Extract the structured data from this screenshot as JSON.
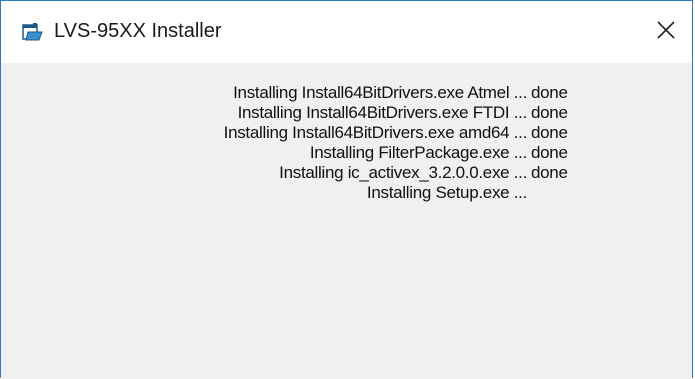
{
  "window": {
    "title": "LVS-95XX Installer",
    "app_icon": "installer-window-icon",
    "close_icon": "close-icon"
  },
  "log": {
    "lines": [
      {
        "text": "Installing Install64BitDrivers.exe Atmel ...",
        "status": "done"
      },
      {
        "text": "Installing Install64BitDrivers.exe FTDI ...",
        "status": "done"
      },
      {
        "text": "Installing Install64BitDrivers.exe amd64 ...",
        "status": "done"
      },
      {
        "text": "Installing FilterPackage.exe ...",
        "status": "done"
      },
      {
        "text": "Installing ic_activex_3.2.0.0.exe ...",
        "status": "done"
      },
      {
        "text": "Installing Setup.exe ...",
        "status": ""
      }
    ]
  },
  "colors": {
    "border": "#2b79c2",
    "client_bg": "#f0f0f0",
    "titlebar_bg": "#ffffff"
  }
}
